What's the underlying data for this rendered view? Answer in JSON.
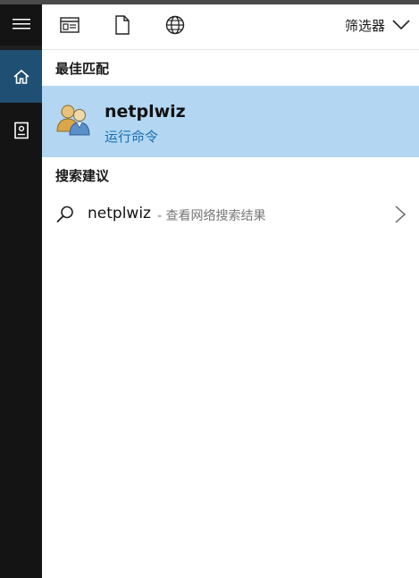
{
  "topbar": {
    "filter_label": "筛选器",
    "icons": [
      "apps-icon",
      "document-icon",
      "globe-icon",
      "chevron-down-icon"
    ]
  },
  "sidebar": {
    "icons": [
      "hamburger-menu-icon",
      "home-icon",
      "notebook-icon"
    ],
    "active": "home"
  },
  "best_match": {
    "section_title": "最佳匹配",
    "name": "netplwiz",
    "subtitle": "运行命令",
    "icon": "user-accounts-icon"
  },
  "suggestions": {
    "section_title": "搜索建议",
    "items": [
      {
        "query": "netplwiz",
        "description": "- 查看网络搜索结果",
        "icon": "search-icon"
      }
    ]
  },
  "colors": {
    "rail": "#141414",
    "rail_active": "#1f4f73",
    "selection": "#b3d7f2",
    "accent_text": "#1a6fb3"
  }
}
